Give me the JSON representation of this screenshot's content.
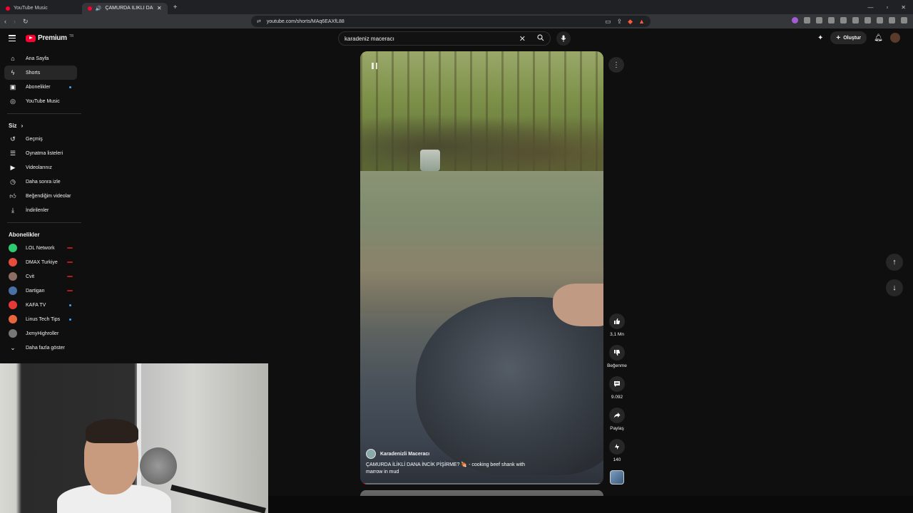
{
  "browser": {
    "tabs": [
      {
        "title": "YouTube Music",
        "active": false
      },
      {
        "title": "ÇAMURDA İLİKLİ DANA İNCİK",
        "active": true
      }
    ],
    "url": "youtube.com/shorts/MAq6EAXfL88"
  },
  "header": {
    "logo_text": "Premium",
    "logo_region": "TR",
    "search_value": "karadeniz maceracı",
    "create_label": "Oluştur"
  },
  "sidebar": {
    "main": [
      {
        "label": "Ana Sayfa",
        "icon": "home-icon"
      },
      {
        "label": "Shorts",
        "icon": "shorts-icon",
        "active": true
      },
      {
        "label": "Abonelikler",
        "icon": "subscriptions-icon",
        "dot": true
      },
      {
        "label": "YouTube Music",
        "icon": "music-icon"
      }
    ],
    "you_title": "Siz",
    "you": [
      {
        "label": "Geçmiş",
        "icon": "history-icon"
      },
      {
        "label": "Oynatma listeleri",
        "icon": "playlist-icon"
      },
      {
        "label": "Videolarınız",
        "icon": "your-videos-icon"
      },
      {
        "label": "Daha sonra izle",
        "icon": "watch-later-icon"
      },
      {
        "label": "Beğendiğim videolar",
        "icon": "liked-icon"
      },
      {
        "label": "İndirilenler",
        "icon": "download-icon"
      }
    ],
    "subs_title": "Abonelikler",
    "subs": [
      {
        "label": "LOL Network",
        "color": "#2ecc71",
        "badge": "live"
      },
      {
        "label": "DMAX Turkiye",
        "color": "#e74c3c",
        "badge": "live"
      },
      {
        "label": "Cvit",
        "color": "#8d6e63",
        "badge": "live"
      },
      {
        "label": "Dartigan",
        "color": "#4a6fa5",
        "badge": "live"
      },
      {
        "label": "KAFA TV",
        "color": "#e53935",
        "badge": "dot"
      },
      {
        "label": "Linus Tech Tips",
        "color": "#e8663d",
        "badge": "dot"
      },
      {
        "label": "JxmyHighroller",
        "color": "#777777",
        "badge": ""
      }
    ],
    "show_more": "Daha fazla göster"
  },
  "short": {
    "channel": "Karadenizli Maceracı",
    "caption": "ÇAMURDA İLİKLİ DANA İNCİK PİŞİRME? 🍖 - cooking beef shank with marrow in mud",
    "progress": 0.02
  },
  "actions": {
    "like_count": "3,1 Mn",
    "dislike_label": "Beğenme",
    "comments_count": "9.092",
    "share_label": "Paylaş",
    "remix_count": "140"
  },
  "colors": {
    "accent": "#ff0033",
    "background": "#0f0f0f",
    "chip": "#272727"
  }
}
